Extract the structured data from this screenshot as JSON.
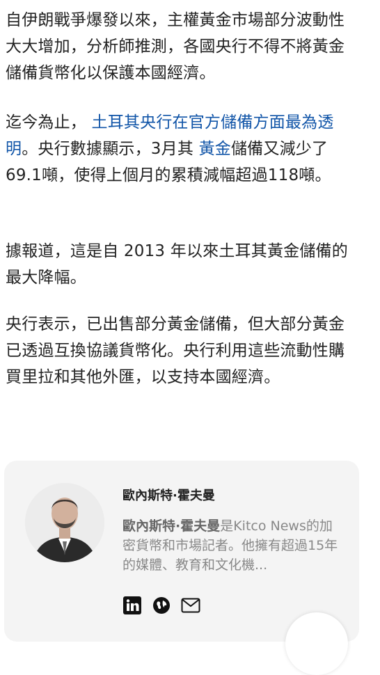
{
  "article": {
    "p1": "自伊朗戰爭爆發以來，主權黃金市場部分波動性大大增加，分析師推測，各國央行不得不將黃金儲備貨幣化以保護本國經濟。",
    "p2_before": "迄今為止，",
    "p2_link1": "土耳其央行在官方儲備方面最為透明",
    "p2_mid": "。央行數據顯示，3月其",
    "p2_link2": "黃金",
    "p2_after": "儲備又減少了69.1噸，使得上個月的累積減幅超過118噸。",
    "p3": "據報道，這是自 2013 年以來土耳其黃金儲備的最大降幅。",
    "p4": "央行表示，已出售部分黃金儲備，但大部分黃金已透過互換協議貨幣化。央行利用這些流動性購買里拉和其他外匯，以支持本國經濟。"
  },
  "author": {
    "name": "歐內斯特·霍夫曼",
    "bio_name": "歐內斯特·霍夫曼",
    "bio_rest": "是Kitco News的加密貨幣和市場記者。他擁有超過15年的媒體、教育和文化機...",
    "social": [
      "linkedin-icon",
      "globe-icon",
      "email-icon"
    ]
  },
  "colors": {
    "link": "#1155a8",
    "card_bg": "#f4f4f4"
  }
}
